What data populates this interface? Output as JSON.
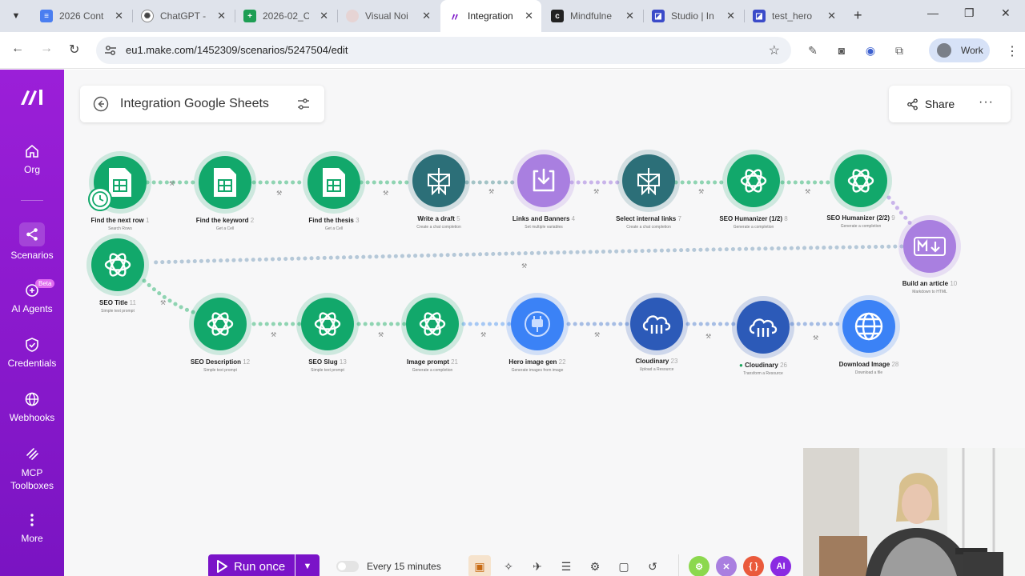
{
  "browser": {
    "tabs": [
      {
        "label": "2026 Cont",
        "icon": "docs-icon",
        "color": "#4a7ef0"
      },
      {
        "label": "ChatGPT -",
        "icon": "chatgpt-icon",
        "color": "#444444"
      },
      {
        "label": "2026-02_C",
        "icon": "sheets-icon",
        "color": "#1e9e54"
      },
      {
        "label": "Visual Noi",
        "icon": "visual-icon",
        "color": "#d8c6c6"
      },
      {
        "label": "Integration",
        "icon": "make-icon",
        "color": "#7a13c8"
      },
      {
        "label": "Mindfulne",
        "icon": "mindfulness-icon",
        "color": "#222222"
      },
      {
        "label": "Studio | In",
        "icon": "studio-icon",
        "color": "#3b4bc9"
      },
      {
        "label": "test_hero",
        "icon": "studio-icon",
        "color": "#3b4bc9"
      }
    ],
    "url": "eu1.make.com/1452309/scenarios/5247504/edit",
    "profile": "Work"
  },
  "sidebar": {
    "items": [
      {
        "label": "Org",
        "icon": "home-icon"
      },
      {
        "label": "Scenarios",
        "icon": "share-nodes-icon"
      },
      {
        "label": "AI Agents",
        "icon": "ai-agent-icon",
        "badge": "Beta"
      },
      {
        "label": "Credentials",
        "icon": "shield-icon"
      },
      {
        "label": "Webhooks",
        "icon": "globe-icon"
      },
      {
        "label": "MCP Toolboxes",
        "icon": "mcp-icon"
      },
      {
        "label": "More",
        "icon": "more-vertical-icon"
      }
    ]
  },
  "header": {
    "title": "Integration Google Sheets",
    "share_label": "Share",
    "more_label": "···"
  },
  "modules": [
    {
      "name": "Find the next row",
      "num": "1",
      "sub": "Search Rows",
      "kind": "sheets"
    },
    {
      "name": "Find the keyword",
      "num": "2",
      "sub": "Get a Cell",
      "kind": "sheets"
    },
    {
      "name": "Find the thesis",
      "num": "3",
      "sub": "Get a Cell",
      "kind": "sheets"
    },
    {
      "name": "Write a draft",
      "num": "5",
      "sub": "Create a chat completion",
      "kind": "perplexity"
    },
    {
      "name": "Links and Banners",
      "num": "4",
      "sub": "Set multiple variables",
      "kind": "tools"
    },
    {
      "name": "Select internal links",
      "num": "7",
      "sub": "Create a chat completion",
      "kind": "perplexity"
    },
    {
      "name": "SEO Humanizer (1/2)",
      "num": "8",
      "sub": "Generate a completion",
      "kind": "openai"
    },
    {
      "name": "SEO Humanizer (2/2)",
      "num": "9",
      "sub": "Generate a completion",
      "kind": "openai"
    },
    {
      "name": "Build an article",
      "num": "10",
      "sub": "Markdown to HTML",
      "kind": "markdown"
    },
    {
      "name": "SEO Title",
      "num": "11",
      "sub": "Simple text prompt",
      "kind": "openai"
    },
    {
      "name": "SEO Description",
      "num": "12",
      "sub": "Simple text prompt",
      "kind": "openai"
    },
    {
      "name": "SEO Slug",
      "num": "13",
      "sub": "Simple text prompt",
      "kind": "openai"
    },
    {
      "name": "Image prompt",
      "num": "21",
      "sub": "Generate a completion",
      "kind": "openai"
    },
    {
      "name": "Hero image gen",
      "num": "22",
      "sub": "Generate images from image",
      "kind": "imagegen"
    },
    {
      "name": "Cloudinary",
      "num": "23",
      "sub": "Upload a Resource",
      "kind": "cloudinary"
    },
    {
      "name": "Cloudinary",
      "num": "26",
      "sub": "Transform a Resource",
      "kind": "cloudinary"
    },
    {
      "name": "Download Image",
      "num": "28",
      "sub": "Download a file",
      "kind": "http"
    }
  ],
  "bottom_bar": {
    "run_label": "Run once",
    "schedule_label": "Every 15 minutes",
    "ai_label": "AI"
  }
}
